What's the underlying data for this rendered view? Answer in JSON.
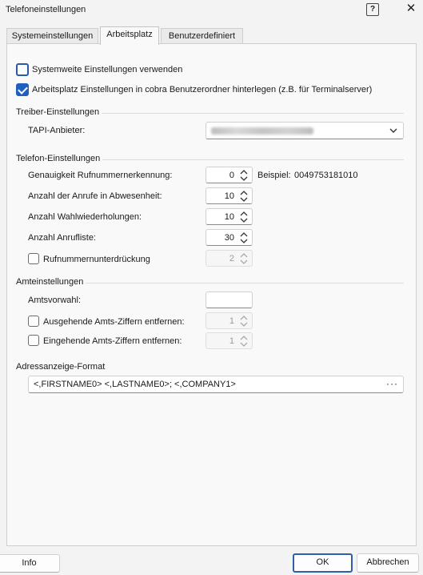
{
  "window": {
    "title": "Telefoneinstellungen",
    "help_icon": "?",
    "close_icon": "✕"
  },
  "tabs": [
    {
      "label": "Systemeinstellungen",
      "active": false
    },
    {
      "label": "Arbeitsplatz",
      "active": true
    },
    {
      "label": "Benutzerdefiniert",
      "active": false
    }
  ],
  "options": {
    "systemwide": {
      "label": "Systemweite Einstellungen verwenden",
      "checked": false
    },
    "workplace_folder": {
      "label": "Arbeitsplatz Einstellungen in cobra Benutzerordner hinterlegen (z.B. für Terminalserver)",
      "checked": true
    }
  },
  "driver": {
    "heading": "Treiber-Einstellungen",
    "tapi_label": "TAPI-Anbieter:"
  },
  "phone": {
    "heading": "Telefon-Einstellungen",
    "accuracy_label": "Genauigkeit Rufnummernerkennung:",
    "accuracy_value": "0",
    "example_label": "Beispiel:",
    "example_value": "0049753181010",
    "absence_calls_label": "Anzahl der Anrufe in Abwesenheit:",
    "absence_calls_value": "10",
    "redial_label": "Anzahl Wahlwiederholungen:",
    "redial_value": "10",
    "call_list_label": "Anzahl Anrufliste:",
    "call_list_value": "30",
    "suppression_label": "Rufnummernunterdrückung",
    "suppression_checked": false,
    "suppression_value": "2"
  },
  "exchange": {
    "heading": "Amteinstellungen",
    "prefix_label": "Amtsvorwahl:",
    "prefix_value": "",
    "outgoing_label": "Ausgehende Amts-Ziffern entfernen:",
    "outgoing_checked": false,
    "outgoing_value": "1",
    "incoming_label": "Eingehende Amts-Ziffern entfernen:",
    "incoming_checked": false,
    "incoming_value": "1"
  },
  "address": {
    "heading": "Adressanzeige-Format",
    "value": "<,FIRSTNAME0> <,LASTNAME0>; <,COMPANY1>",
    "more_label": "···"
  },
  "buttons": {
    "info": "Info",
    "ok": "OK",
    "cancel": "Abbrechen"
  }
}
